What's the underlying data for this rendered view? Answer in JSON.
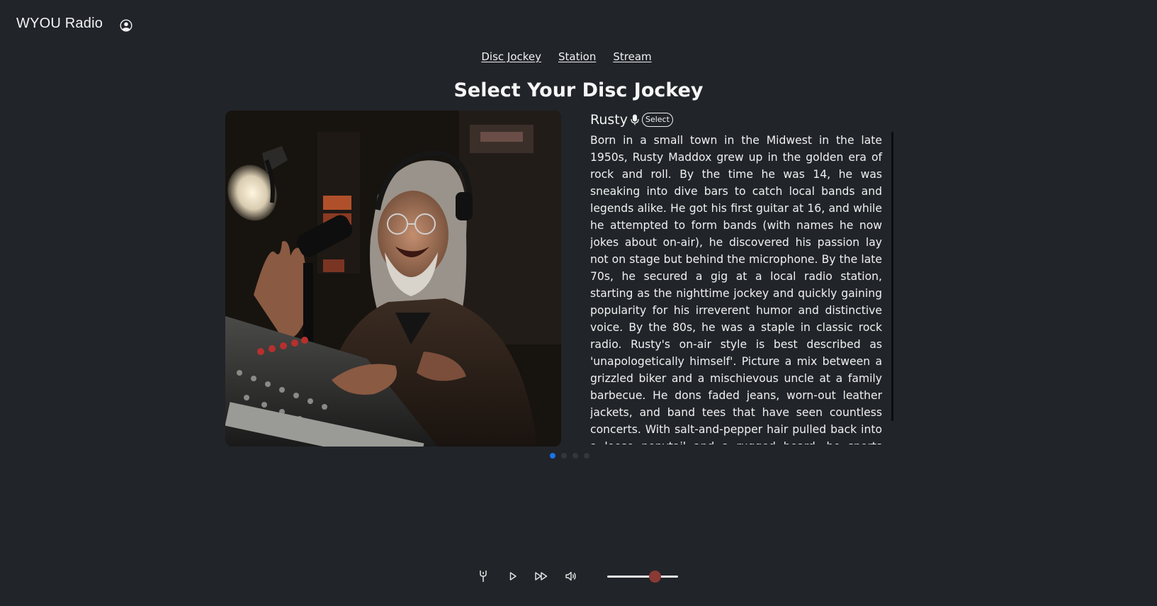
{
  "header": {
    "brand": "WYOU Radio",
    "user_icon": "user-circle-icon"
  },
  "nav": {
    "items": [
      {
        "label": "Disc Jockey"
      },
      {
        "label": "Station"
      },
      {
        "label": "Stream"
      }
    ]
  },
  "main": {
    "title": "Select Your Disc Jockey",
    "dj": {
      "name": "Rusty",
      "mic_icon": "microphone-icon",
      "select_label": "Select",
      "bio": "Born in a small town in the Midwest in the late 1950s, Rusty Maddox grew up in the golden era of rock and roll. By the time he was 14, he was sneaking into dive bars to catch local bands and legends alike. He got his first guitar at 16, and while he attempted to form bands (with names he now jokes about on-air), he discovered his passion lay not on stage but behind the microphone. By the late 70s, he secured a gig at a local radio station, starting as the nighttime jockey and quickly gaining popularity for his irreverent humor and distinctive voice. By the 80s, he was a staple in classic rock radio. Rusty's on-air style is best described as 'unapologetically himself'. Picture a mix between a grizzled biker and a mischievous uncle at a family barbecue. He dons faded jeans, worn-out leather jackets, and band tees that have seen countless concerts. With salt-and-pepper hair pulled back into a loose ponytail and a rugged beard, he sports classic aviator sunglasses, which he claims were a gift from a rock-and-roll legend backstage."
    },
    "carousel": {
      "count": 4,
      "active_index": 0
    }
  },
  "player": {
    "buttons": [
      "mic-tool-icon",
      "play-icon",
      "fast-forward-icon",
      "volume-icon"
    ],
    "volume_level": 0.67
  },
  "colors": {
    "background": "#212429",
    "accent_dot": "#1a73e8",
    "volume_thumb": "#8a3a34"
  }
}
